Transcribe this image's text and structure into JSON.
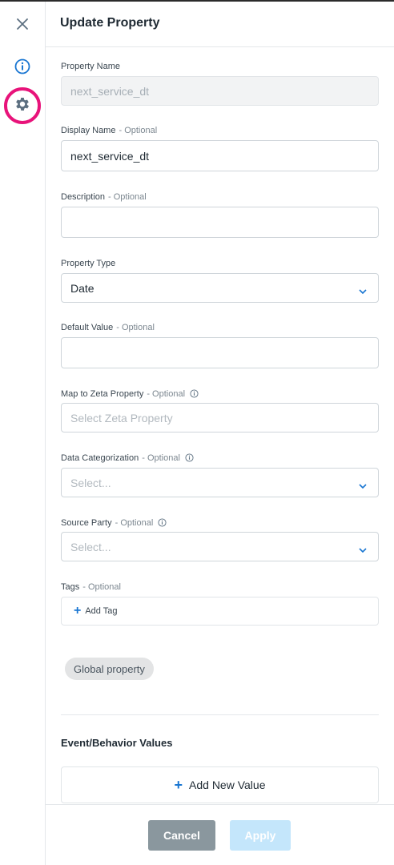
{
  "header": {
    "title": "Update Property"
  },
  "fields": {
    "property_name": {
      "label": "Property Name",
      "value": "next_service_dt"
    },
    "display_name": {
      "label": "Display Name",
      "optional": "- Optional",
      "value": "next_service_dt"
    },
    "description": {
      "label": "Description",
      "optional": "- Optional",
      "value": ""
    },
    "property_type": {
      "label": "Property Type",
      "value": "Date"
    },
    "default_value": {
      "label": "Default Value",
      "optional": "- Optional",
      "value": ""
    },
    "map_to_zeta": {
      "label": "Map to Zeta Property",
      "optional": "- Optional",
      "placeholder": "Select Zeta Property"
    },
    "data_categorization": {
      "label": "Data Categorization",
      "optional": "- Optional",
      "placeholder": "Select..."
    },
    "source_party": {
      "label": "Source Party",
      "optional": "- Optional",
      "placeholder": "Select..."
    },
    "tags": {
      "label": "Tags",
      "optional": "- Optional",
      "add_label": "Add Tag"
    }
  },
  "chip": {
    "label": "Global property"
  },
  "values_section": {
    "title": "Event/Behavior Values",
    "add_label": "Add New Value"
  },
  "footer": {
    "cancel_label": "Cancel",
    "apply_label": "Apply"
  },
  "colors": {
    "accent": "#1976d2",
    "highlight_ring": "#e8137a",
    "cancel_bg": "#8a979e",
    "apply_bg_disabled": "#c4e6fb"
  },
  "icons": {
    "close": "close-icon",
    "info": "info-icon",
    "settings": "gear-icon",
    "chevron": "chevron-down-icon",
    "plus": "plus-icon"
  }
}
